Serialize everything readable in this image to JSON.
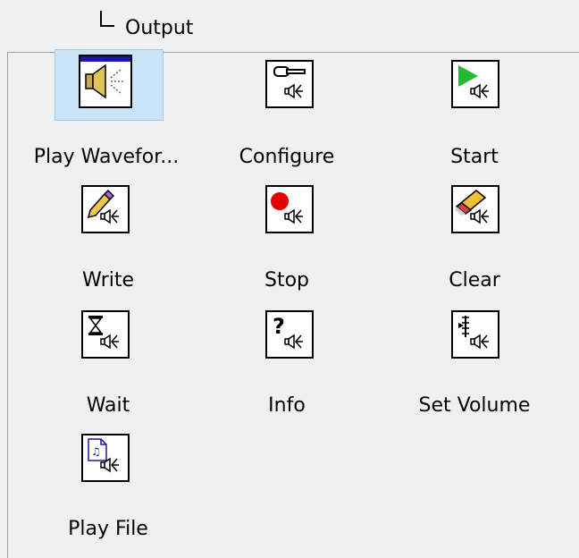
{
  "header": {
    "title": "Output"
  },
  "palette": {
    "items": [
      {
        "label": "Play Wavefor...",
        "icon": "speaker-play-waveform-icon",
        "selected": true
      },
      {
        "label": "Configure",
        "icon": "wrench-speaker-icon",
        "selected": false
      },
      {
        "label": "Start",
        "icon": "play-speaker-icon",
        "selected": false
      },
      {
        "label": "Write",
        "icon": "pencil-speaker-icon",
        "selected": false
      },
      {
        "label": "Stop",
        "icon": "stop-speaker-icon",
        "selected": false
      },
      {
        "label": "Clear",
        "icon": "eraser-speaker-icon",
        "selected": false
      },
      {
        "label": "Wait",
        "icon": "hourglass-speaker-icon",
        "selected": false
      },
      {
        "label": "Info",
        "icon": "question-speaker-icon",
        "selected": false
      },
      {
        "label": "Set Volume",
        "icon": "volume-speaker-icon",
        "selected": false
      },
      {
        "label": "Play File",
        "icon": "file-speaker-icon",
        "selected": false
      }
    ]
  }
}
